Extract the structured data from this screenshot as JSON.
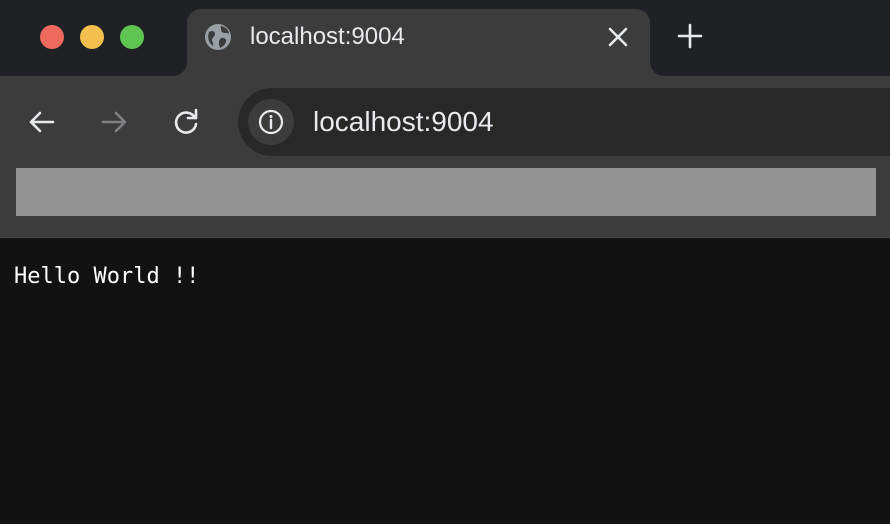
{
  "window": {
    "traffic_lights": {
      "close_color": "#ee6a5f",
      "minimize_color": "#f5bf4f",
      "zoom_color": "#61c554"
    }
  },
  "tab": {
    "title": "localhost:9004",
    "favicon": "globe-icon",
    "close_icon": "close-icon"
  },
  "new_tab": {
    "icon": "plus-icon"
  },
  "toolbar": {
    "back_icon": "arrow-left-icon",
    "forward_icon": "arrow-right-icon",
    "reload_icon": "reload-icon"
  },
  "omnibox": {
    "site_info_icon": "info-icon",
    "url": "localhost:9004"
  },
  "page": {
    "text": "Hello World !!"
  },
  "colors": {
    "tabstrip_bg": "#202124",
    "active_tab_bg": "#3c3c3c",
    "omnibox_bg": "#282828",
    "grey_bar": "#939393",
    "content_bg": "#121212",
    "text": "#e8eaed"
  }
}
